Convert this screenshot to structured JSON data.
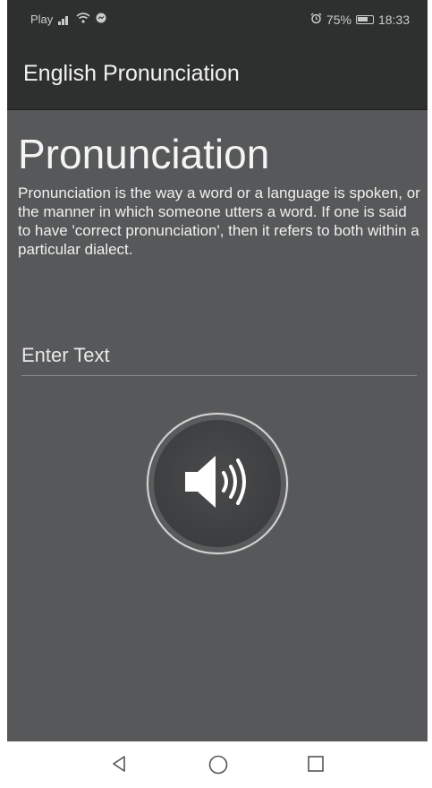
{
  "status_bar": {
    "carrier": "Play",
    "battery_percent": "75%",
    "time": "18:33"
  },
  "app_bar": {
    "title": "English Pronunciation"
  },
  "main": {
    "heading": "Pronunciation",
    "description": "Pronunciation is the way a word or a language is spoken, or the manner in which someone utters a word. If one is said to have 'correct pronunciation', then it refers to both within a particular dialect.",
    "input": {
      "placeholder": "Enter Text",
      "value": ""
    },
    "speak_button_icon": "speaker-icon"
  },
  "nav_bar": {
    "icons": [
      "back-icon",
      "home-icon",
      "recents-icon"
    ]
  },
  "colors": {
    "app_bar": "#2e3030",
    "content_bg": "#575859",
    "text": "#f4f4f4"
  }
}
